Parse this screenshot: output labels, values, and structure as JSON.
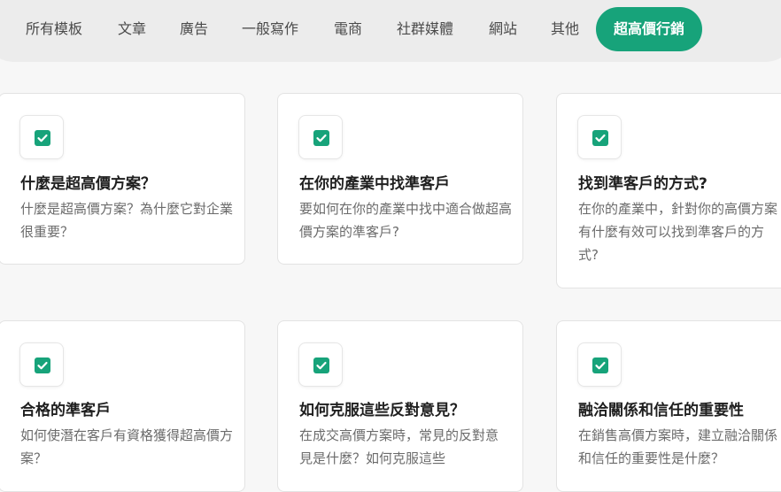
{
  "tabs": [
    {
      "label": "所有模板"
    },
    {
      "label": "文章"
    },
    {
      "label": "廣告"
    },
    {
      "label": "一般寫作"
    },
    {
      "label": "電商"
    },
    {
      "label": "社群媒體"
    },
    {
      "label": "網站"
    },
    {
      "label": "其他"
    },
    {
      "label": "超高價行銷",
      "active": true
    }
  ],
  "accent_color": "#17a37a",
  "icon": "checkbox-checked-icon",
  "cards": [
    {
      "title": "什麼是超高價方案？",
      "desc": "什麼是超高價方案？為什麼它對企業很重要？"
    },
    {
      "title": "在你的產業中找準客戶",
      "desc": "要如何在你的產業中找中適合做超高價方案的準客戶?"
    },
    {
      "title": "找到準客戶的方式?",
      "desc": "在你的產業中，針對你的高價方案有什麼有效可以找到準客戶的方式?"
    },
    {
      "title": "合格的準客戶",
      "desc": "如何使潛在客戶有資格獲得超高價方案？"
    },
    {
      "title": "如何克服這些反對意見？",
      "desc": "在成交高價方案時，常見的反對意見是什麼？如何克服這些"
    },
    {
      "title": "融洽關係和信任的重要性",
      "desc": "在銷售高價方案時，建立融洽關係和信任的重要性是什麼？"
    }
  ]
}
